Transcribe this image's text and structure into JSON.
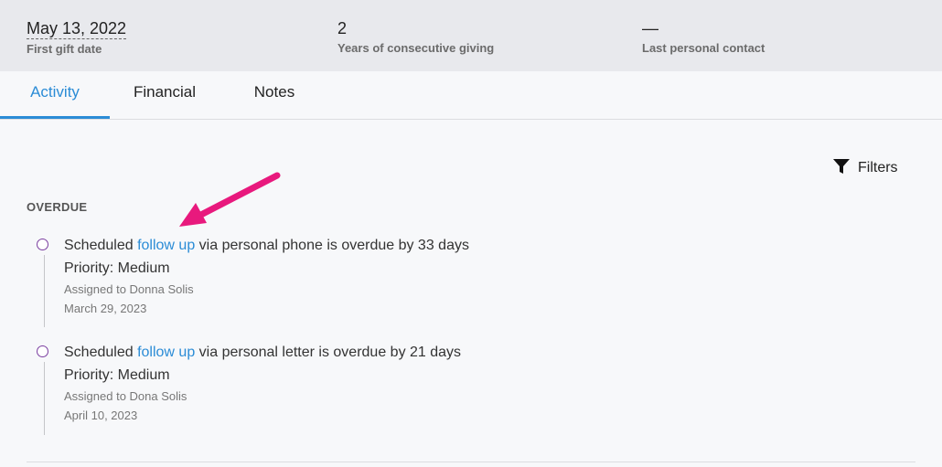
{
  "stats": [
    {
      "value": "May 13, 2022",
      "label": "First gift date"
    },
    {
      "value": "2",
      "label": "Years of consecutive giving"
    },
    {
      "value": "—",
      "label": "Last personal contact"
    }
  ],
  "tabs": [
    {
      "label": "Activity",
      "active": true
    },
    {
      "label": "Financial",
      "active": false
    },
    {
      "label": "Notes",
      "active": false
    }
  ],
  "filters": {
    "label": "Filters",
    "icon": "filter-icon"
  },
  "section": {
    "label": "OVERDUE"
  },
  "items": [
    {
      "prefix": "Scheduled ",
      "link": "follow up",
      "suffix": " via personal phone is overdue by 33 days",
      "priority": "Priority: Medium",
      "assigned": "Assigned to Donna Solis",
      "date": "March 29, 2023"
    },
    {
      "prefix": "Scheduled ",
      "link": "follow up",
      "suffix": " via personal letter is overdue by 21 days",
      "priority": "Priority: Medium",
      "assigned": "Assigned to Dona Solis",
      "date": "April 10, 2023"
    }
  ],
  "colors": {
    "accent": "#2b8cd6",
    "annotation_arrow": "#e8197d",
    "timeline_dot": "#7b3fa0"
  }
}
